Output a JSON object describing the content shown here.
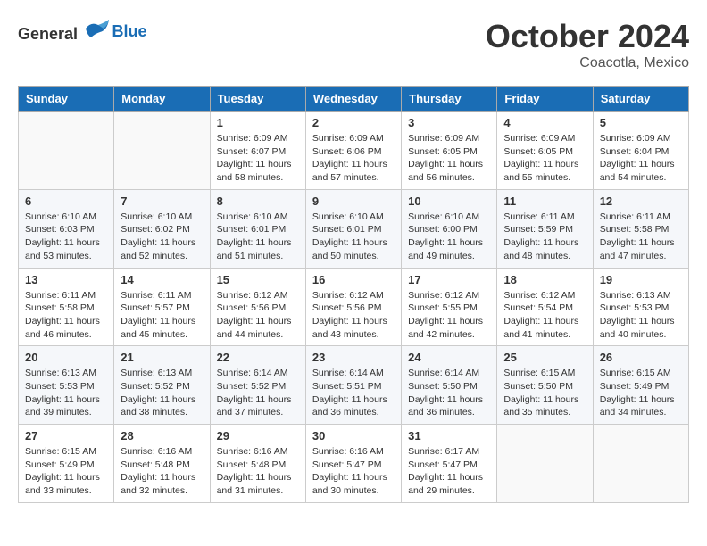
{
  "logo": {
    "general": "General",
    "blue": "Blue"
  },
  "title": "October 2024",
  "location": "Coacotla, Mexico",
  "days_of_week": [
    "Sunday",
    "Monday",
    "Tuesday",
    "Wednesday",
    "Thursday",
    "Friday",
    "Saturday"
  ],
  "weeks": [
    [
      {
        "day": "",
        "info": ""
      },
      {
        "day": "",
        "info": ""
      },
      {
        "day": "1",
        "info": "Sunrise: 6:09 AM\nSunset: 6:07 PM\nDaylight: 11 hours and 58 minutes."
      },
      {
        "day": "2",
        "info": "Sunrise: 6:09 AM\nSunset: 6:06 PM\nDaylight: 11 hours and 57 minutes."
      },
      {
        "day": "3",
        "info": "Sunrise: 6:09 AM\nSunset: 6:05 PM\nDaylight: 11 hours and 56 minutes."
      },
      {
        "day": "4",
        "info": "Sunrise: 6:09 AM\nSunset: 6:05 PM\nDaylight: 11 hours and 55 minutes."
      },
      {
        "day": "5",
        "info": "Sunrise: 6:09 AM\nSunset: 6:04 PM\nDaylight: 11 hours and 54 minutes."
      }
    ],
    [
      {
        "day": "6",
        "info": "Sunrise: 6:10 AM\nSunset: 6:03 PM\nDaylight: 11 hours and 53 minutes."
      },
      {
        "day": "7",
        "info": "Sunrise: 6:10 AM\nSunset: 6:02 PM\nDaylight: 11 hours and 52 minutes."
      },
      {
        "day": "8",
        "info": "Sunrise: 6:10 AM\nSunset: 6:01 PM\nDaylight: 11 hours and 51 minutes."
      },
      {
        "day": "9",
        "info": "Sunrise: 6:10 AM\nSunset: 6:01 PM\nDaylight: 11 hours and 50 minutes."
      },
      {
        "day": "10",
        "info": "Sunrise: 6:10 AM\nSunset: 6:00 PM\nDaylight: 11 hours and 49 minutes."
      },
      {
        "day": "11",
        "info": "Sunrise: 6:11 AM\nSunset: 5:59 PM\nDaylight: 11 hours and 48 minutes."
      },
      {
        "day": "12",
        "info": "Sunrise: 6:11 AM\nSunset: 5:58 PM\nDaylight: 11 hours and 47 minutes."
      }
    ],
    [
      {
        "day": "13",
        "info": "Sunrise: 6:11 AM\nSunset: 5:58 PM\nDaylight: 11 hours and 46 minutes."
      },
      {
        "day": "14",
        "info": "Sunrise: 6:11 AM\nSunset: 5:57 PM\nDaylight: 11 hours and 45 minutes."
      },
      {
        "day": "15",
        "info": "Sunrise: 6:12 AM\nSunset: 5:56 PM\nDaylight: 11 hours and 44 minutes."
      },
      {
        "day": "16",
        "info": "Sunrise: 6:12 AM\nSunset: 5:56 PM\nDaylight: 11 hours and 43 minutes."
      },
      {
        "day": "17",
        "info": "Sunrise: 6:12 AM\nSunset: 5:55 PM\nDaylight: 11 hours and 42 minutes."
      },
      {
        "day": "18",
        "info": "Sunrise: 6:12 AM\nSunset: 5:54 PM\nDaylight: 11 hours and 41 minutes."
      },
      {
        "day": "19",
        "info": "Sunrise: 6:13 AM\nSunset: 5:53 PM\nDaylight: 11 hours and 40 minutes."
      }
    ],
    [
      {
        "day": "20",
        "info": "Sunrise: 6:13 AM\nSunset: 5:53 PM\nDaylight: 11 hours and 39 minutes."
      },
      {
        "day": "21",
        "info": "Sunrise: 6:13 AM\nSunset: 5:52 PM\nDaylight: 11 hours and 38 minutes."
      },
      {
        "day": "22",
        "info": "Sunrise: 6:14 AM\nSunset: 5:52 PM\nDaylight: 11 hours and 37 minutes."
      },
      {
        "day": "23",
        "info": "Sunrise: 6:14 AM\nSunset: 5:51 PM\nDaylight: 11 hours and 36 minutes."
      },
      {
        "day": "24",
        "info": "Sunrise: 6:14 AM\nSunset: 5:50 PM\nDaylight: 11 hours and 36 minutes."
      },
      {
        "day": "25",
        "info": "Sunrise: 6:15 AM\nSunset: 5:50 PM\nDaylight: 11 hours and 35 minutes."
      },
      {
        "day": "26",
        "info": "Sunrise: 6:15 AM\nSunset: 5:49 PM\nDaylight: 11 hours and 34 minutes."
      }
    ],
    [
      {
        "day": "27",
        "info": "Sunrise: 6:15 AM\nSunset: 5:49 PM\nDaylight: 11 hours and 33 minutes."
      },
      {
        "day": "28",
        "info": "Sunrise: 6:16 AM\nSunset: 5:48 PM\nDaylight: 11 hours and 32 minutes."
      },
      {
        "day": "29",
        "info": "Sunrise: 6:16 AM\nSunset: 5:48 PM\nDaylight: 11 hours and 31 minutes."
      },
      {
        "day": "30",
        "info": "Sunrise: 6:16 AM\nSunset: 5:47 PM\nDaylight: 11 hours and 30 minutes."
      },
      {
        "day": "31",
        "info": "Sunrise: 6:17 AM\nSunset: 5:47 PM\nDaylight: 11 hours and 29 minutes."
      },
      {
        "day": "",
        "info": ""
      },
      {
        "day": "",
        "info": ""
      }
    ]
  ]
}
